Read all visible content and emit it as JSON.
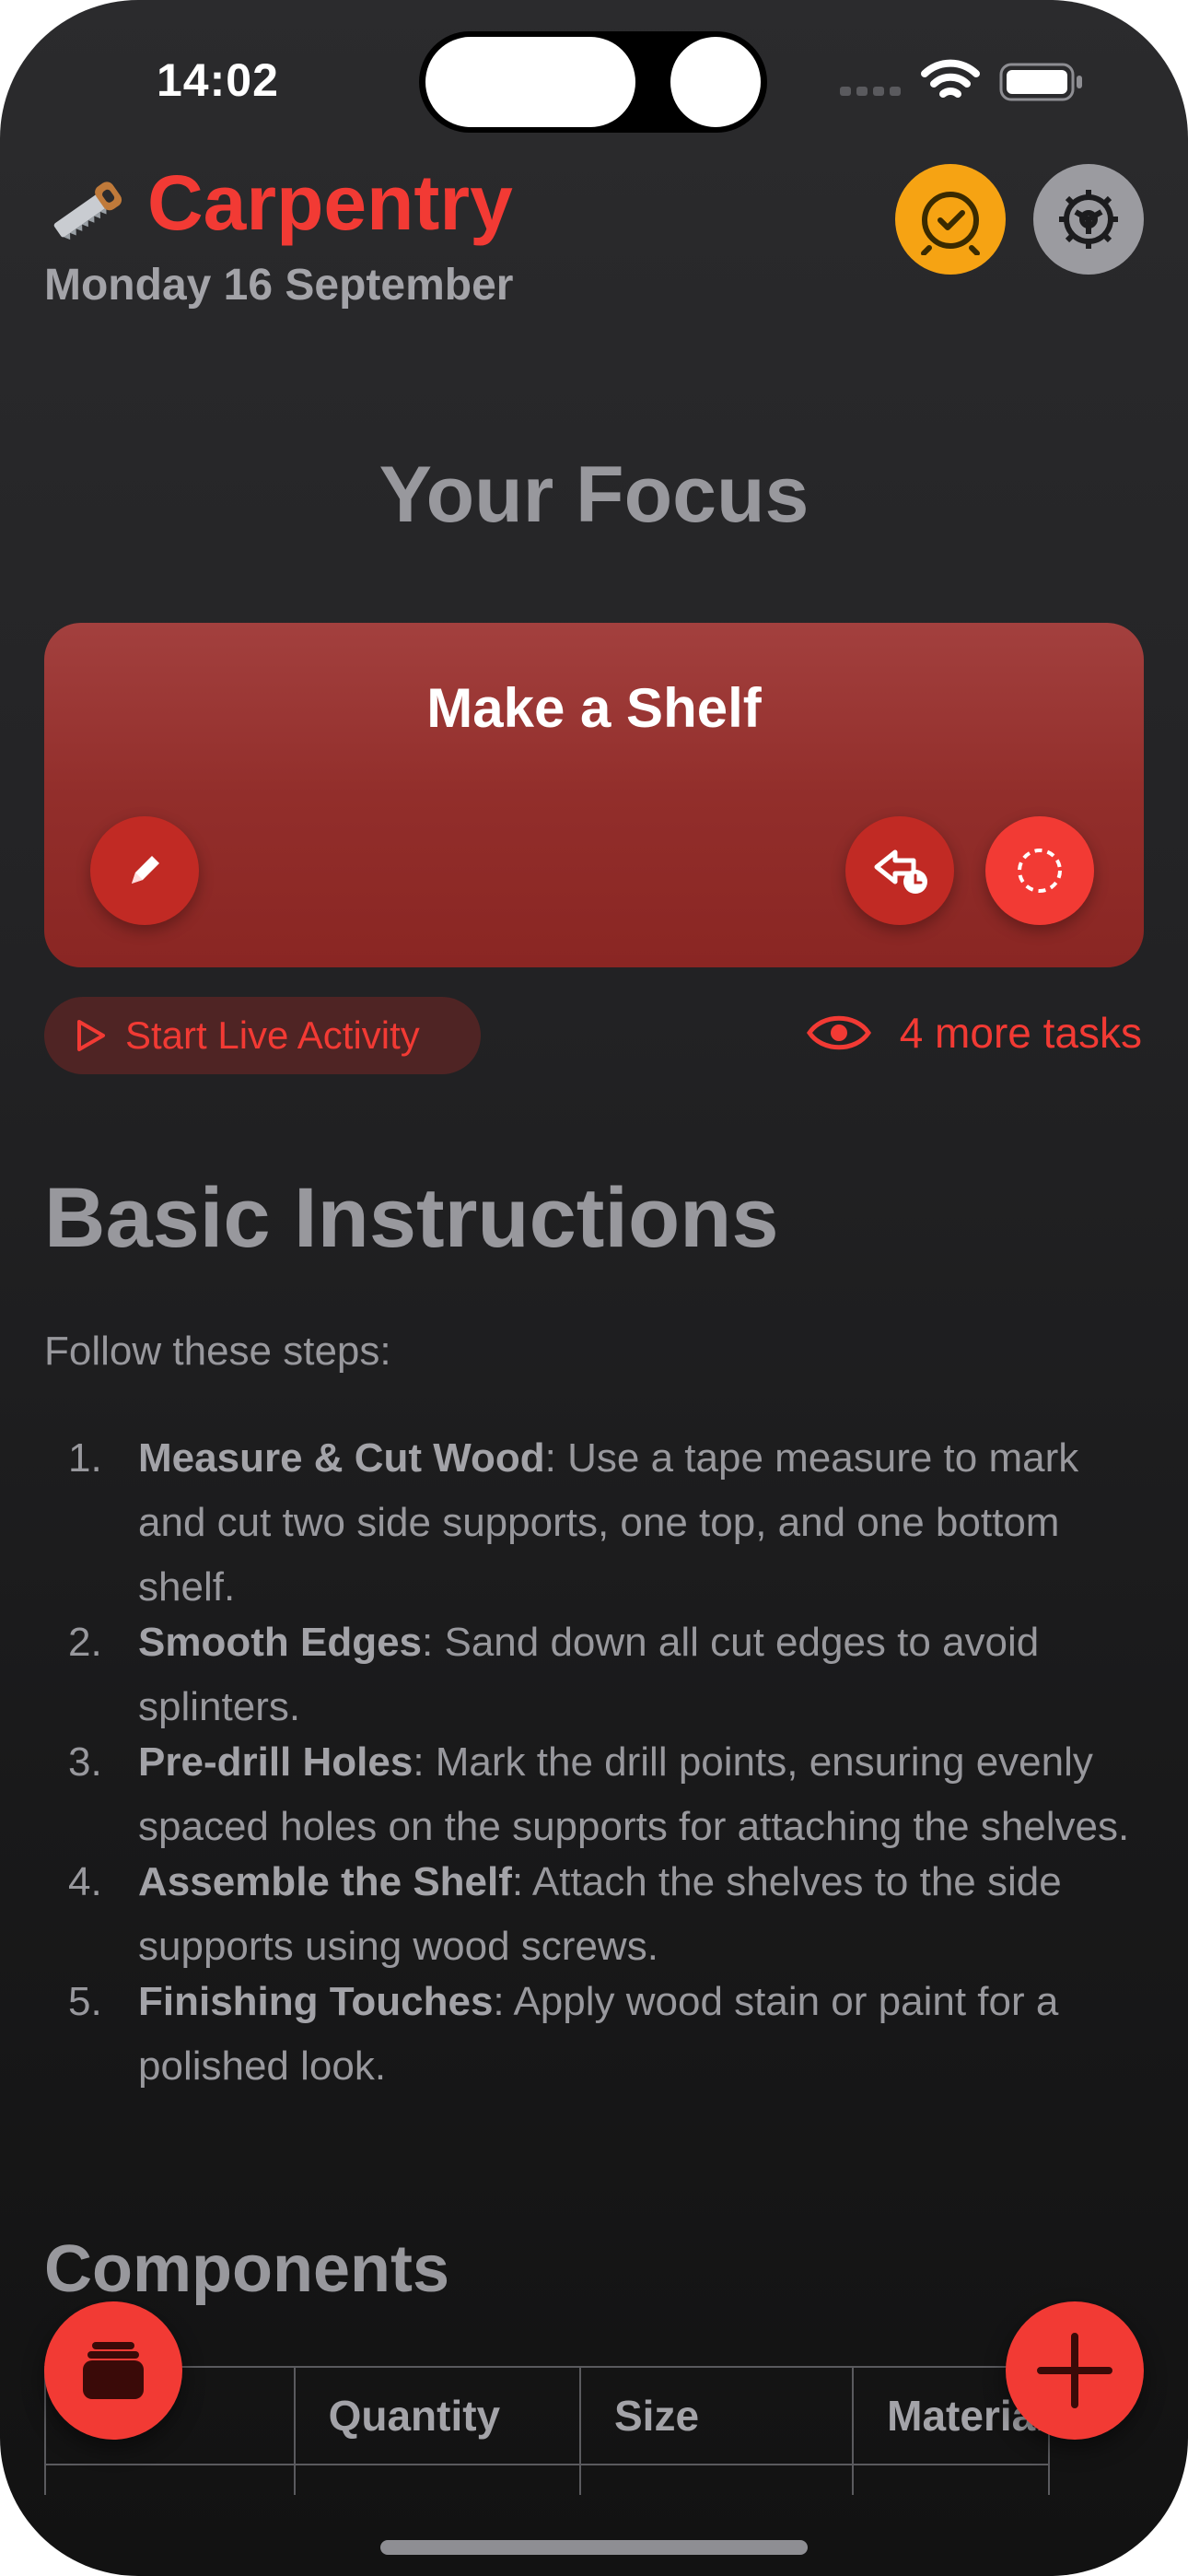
{
  "status_bar": {
    "time": "14:02",
    "signal_icon": "cellular-signal-icon",
    "wifi_icon": "wifi-icon",
    "battery_icon": "battery-icon"
  },
  "header": {
    "app_icon": "saw-icon",
    "title": "Carpentry",
    "date": "Monday 16 September",
    "accent_color": "#f23a34",
    "clock_button_icon": "alarm-clock-icon",
    "clock_button_color": "#f6a313",
    "settings_button_icon": "gear-icon"
  },
  "focus": {
    "heading": "Your Focus",
    "task_title": "Make a Shelf",
    "edit_icon": "pencil-icon",
    "defer_icon": "defer-clock-icon",
    "complete_icon": "dashed-circle-icon",
    "live_activity_label": "Start Live Activity",
    "more_tasks_label": "4 more tasks"
  },
  "document": {
    "heading": "Basic Instructions",
    "intro": "Follow these steps:",
    "steps": [
      {
        "number": "1.",
        "title": "Measure & Cut Wood",
        "text": ": Use a tape measure to mark and cut two side supports, one top, and one bottom shelf."
      },
      {
        "number": "2.",
        "title": "Smooth Edges",
        "text": ": Sand down all cut edges to avoid splinters."
      },
      {
        "number": "3.",
        "title": "Pre-drill Holes",
        "text": ": Mark the drill points, ensuring evenly spaced holes on the supports for attaching the shelves."
      },
      {
        "number": "4.",
        "title": "Assemble the Shelf",
        "text": ": Attach the shelves to the side supports using wood screws."
      },
      {
        "number": "5.",
        "title": "Finishing Touches",
        "text": ": Apply wood stain or paint for a polished look."
      }
    ],
    "components_heading": "Components",
    "table_headers": [
      "",
      "Quantity",
      "Size",
      "Material"
    ]
  },
  "fab": {
    "left_icon": "stack-icon",
    "right_icon": "plus-icon"
  }
}
